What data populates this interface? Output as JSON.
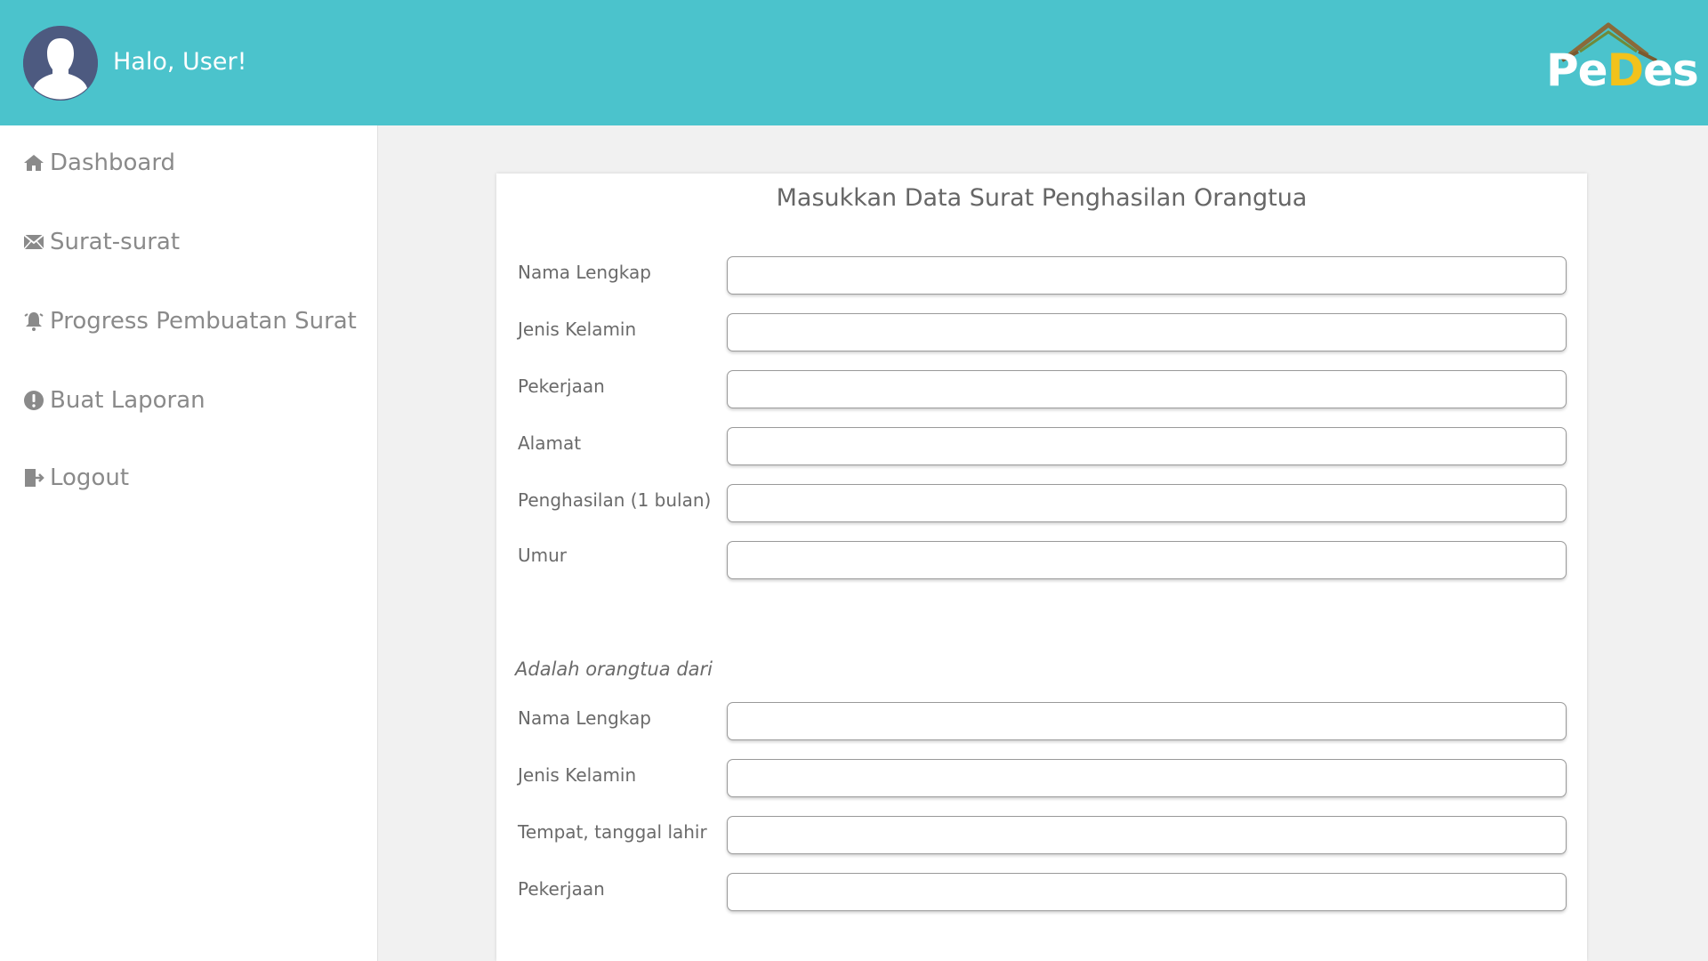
{
  "header": {
    "greeting": "Halo, User!",
    "avatar_icon": "user-avatar-icon",
    "logo": {
      "part1": "Pe",
      "part2": "D",
      "part3": "es",
      "color_main": "#ffffff",
      "color_accent": "#f2c21b"
    },
    "background_color": "#4bc3cc"
  },
  "sidebar": {
    "items": [
      {
        "label": "Dashboard",
        "icon": "home-icon"
      },
      {
        "label": "Surat-surat",
        "icon": "envelope-icon"
      },
      {
        "label": "Progress Pembuatan Surat",
        "icon": "bell-icon"
      },
      {
        "label": "Buat Laporan",
        "icon": "exclamation-circle-icon"
      },
      {
        "label": "Logout",
        "icon": "sign-out-icon"
      }
    ]
  },
  "form": {
    "title": "Masukkan Data Surat Penghasilan Orangtua",
    "parent_fields": [
      {
        "label": "Nama Lengkap",
        "value": ""
      },
      {
        "label": "Jenis Kelamin",
        "value": ""
      },
      {
        "label": "Pekerjaan",
        "value": ""
      },
      {
        "label": "Alamat",
        "value": ""
      },
      {
        "label": "Penghasilan (1 bulan)",
        "value": ""
      },
      {
        "label": "Umur",
        "value": ""
      }
    ],
    "child_section_title": "Adalah orangtua dari",
    "child_fields": [
      {
        "label": "Nama Lengkap",
        "value": ""
      },
      {
        "label": "Jenis Kelamin",
        "value": ""
      },
      {
        "label": "Tempat, tanggal lahir",
        "value": ""
      },
      {
        "label": "Pekerjaan",
        "value": ""
      }
    ]
  }
}
